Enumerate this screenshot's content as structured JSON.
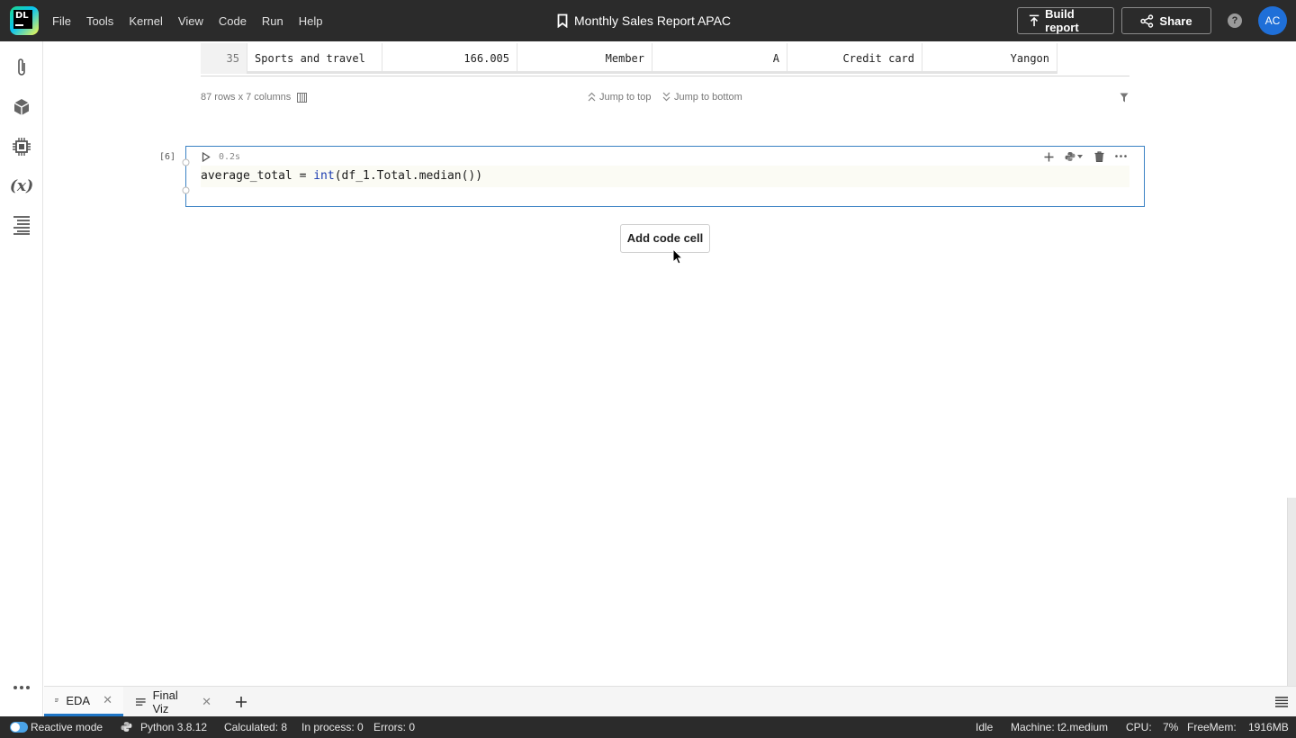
{
  "app": {
    "logo_text": "DL",
    "menu": [
      "File",
      "Tools",
      "Kernel",
      "View",
      "Code",
      "Run",
      "Help"
    ],
    "title": "Monthly Sales Report APAC",
    "build_label": "Build report",
    "share_label": "Share",
    "help_glyph": "?",
    "avatar_initials": "AC"
  },
  "table": {
    "row": {
      "index": "35",
      "cells": [
        "Sports and travel",
        "166.005",
        "Member",
        "A",
        "Credit card",
        "Yangon"
      ]
    },
    "summary": "87 rows x 7 columns",
    "jump_top": "Jump to top",
    "jump_bottom": "Jump to bottom"
  },
  "cell": {
    "number": "[6]",
    "exec_time": "0.2s",
    "code_var": "average_total",
    "code_op": " = ",
    "code_fn": "int",
    "code_rest": "(df_1.Total.median())"
  },
  "add_code_cell_label": "Add code cell",
  "tabs": [
    {
      "label": "EDA",
      "active": true
    },
    {
      "label": "Final Viz",
      "active": false
    }
  ],
  "status": {
    "reactive": "Reactive mode",
    "python": "Python 3.8.12",
    "calculated": "Calculated: 8",
    "in_process": "In process: 0",
    "errors": "Errors: 0",
    "kernel_state": "Idle",
    "machine": "Machine: t2.medium",
    "cpu_label": "CPU:",
    "cpu_value": "7%",
    "freemem_label": "FreeMem:",
    "freemem_value": "1916MB"
  },
  "colors": {
    "topbar": "#2b2b2b",
    "accent": "#1f76c6",
    "cell_border": "#3b82c4",
    "avatar": "#1f6fd8"
  }
}
